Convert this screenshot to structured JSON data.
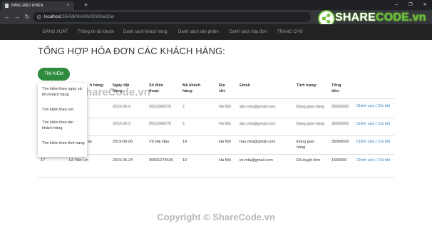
{
  "browser": {
    "tab_title": "BẢNG ĐIỀU KHIỂN",
    "tab_close": "×",
    "new_tab": "+",
    "win_minimize": "─",
    "win_restore": "❐",
    "win_close": "✕",
    "url_host": "localhost",
    "url_rest": ":55459/NHANVIEN/HoaDon",
    "back": "←",
    "forward": "→",
    "reload": "↻"
  },
  "nav": {
    "items": [
      {
        "label": "ĐĂNG XUẤT"
      },
      {
        "label": "Thông tin tài khoản"
      },
      {
        "label": "Danh sách khách hàng"
      },
      {
        "label": "Danh sách sản phẩm"
      },
      {
        "label": "Danh sách hóa đơn"
      },
      {
        "label": "TRANG CHỦ"
      }
    ]
  },
  "watermark": {
    "logo_part1": "SHARE",
    "logo_part2": "CODE.vn",
    "mid": "ShareCode.vn",
    "footer": "Copyright © ShareCode.vn"
  },
  "main": {
    "title": "TỔNG HỢP HÓA ĐƠN CÁC KHÁCH HÀNG:",
    "search_button": "TÌM KIẾM"
  },
  "dropdown": {
    "items": [
      {
        "label": "Tìm kiếm theo ngày và tên khách hàng"
      },
      {
        "label": "Tìm kiếm theo nơi"
      },
      {
        "label": "Tìm kiếm theo tên khách hàng"
      },
      {
        "label": "Tìm kiếm theo tình trạng"
      }
    ]
  },
  "table": {
    "headers": {
      "name": "h hàng:",
      "date": "Ngày đặt hàng:",
      "phone": "Số điện thoại:",
      "customer_id": "Mã khách hàng:",
      "address": "Địa chỉ:",
      "email": "Email",
      "status": "Tình trạng:",
      "total": "Tổng tiền:"
    },
    "rows": [
      {
        "id": "",
        "name": "",
        "date": "2019-06-0",
        "phone": "0912345678",
        "customer_id": "1",
        "address": "Hà Nội",
        "email": "abc.mta@gmail.com",
        "status": "Đang giao hàng",
        "total": "35000000",
        "edit": "Chỉnh sửa",
        "detail": "Chi tiết"
      },
      {
        "id": "",
        "name": "",
        "date": "2019-06-0",
        "phone": "0912345678",
        "customer_id": "2",
        "address": "Hà Nội",
        "email": "abc.mta@gmail.com",
        "status": "Đang giao hàng",
        "total": "35000000",
        "edit": "Chỉnh sửa",
        "detail": "Chi tiết"
      },
      {
        "id": "",
        "name": "ầu",
        "date": "2019-06-06",
        "phone": "Vũ Hải Hậu",
        "customer_id": "14",
        "address": "Hà Nội",
        "email": "hau.mta@gmail.com",
        "status": "Đang giao hàng",
        "total": "35000000",
        "edit": "Chỉnh sửa",
        "detail": "Chi tiết"
      },
      {
        "id": "17",
        "name": "Lê Văn Lợi",
        "date": "2019-06-24",
        "phone": "09991274536",
        "customer_id": "10",
        "address": "Hà Nội",
        "email": "loi.mta@gmail.com",
        "status": "Đã duyệt đơn",
        "total": "1500000",
        "edit": "Chỉnh sửa",
        "detail": "Chi tiết"
      }
    ],
    "separator": " | "
  },
  "colors": {
    "accent_green": "#2e8b3e",
    "link_blue": "#337ab7",
    "navbar": "#222222"
  }
}
